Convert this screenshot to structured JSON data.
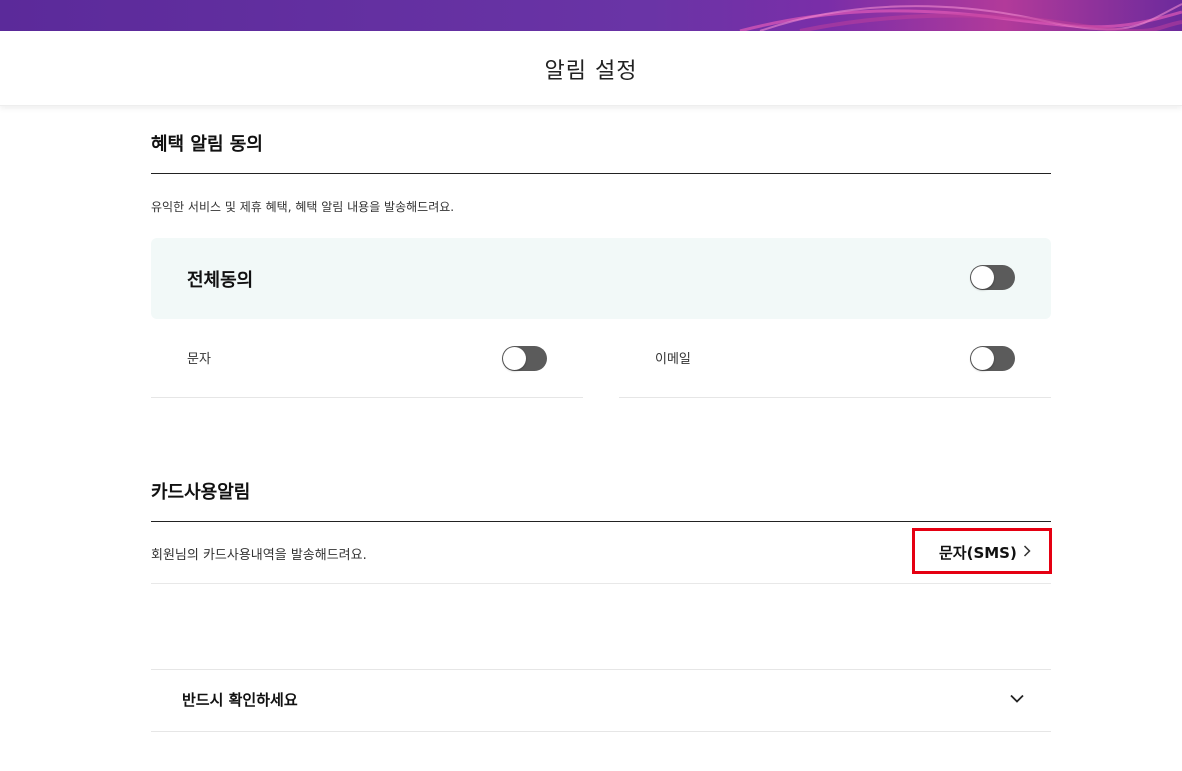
{
  "colors": {
    "banner_primary": "#6a34a6",
    "highlight_box": "#e50012",
    "toggle_off": "#5b5b5b",
    "panel_bg": "#f2f9f8"
  },
  "header": {
    "title": "알림 설정"
  },
  "benefit_section": {
    "title": "혜택 알림 동의",
    "description": "유익한 서비스 및 제휴 혜택, 혜택 알림 내용을 발송해드려요.",
    "all_agree": {
      "label": "전체동의",
      "enabled": false
    },
    "channels": [
      {
        "label": "문자",
        "enabled": false
      },
      {
        "label": "이메일",
        "enabled": false
      }
    ]
  },
  "card_section": {
    "title": "카드사용알림",
    "description": "회원님의 카드사용내역을 발송해드려요.",
    "method_label": "문자(SMS)",
    "method_icon": "chevron-right-icon"
  },
  "notice": {
    "label": "반드시 확인하세요",
    "icon": "chevron-down-icon"
  }
}
